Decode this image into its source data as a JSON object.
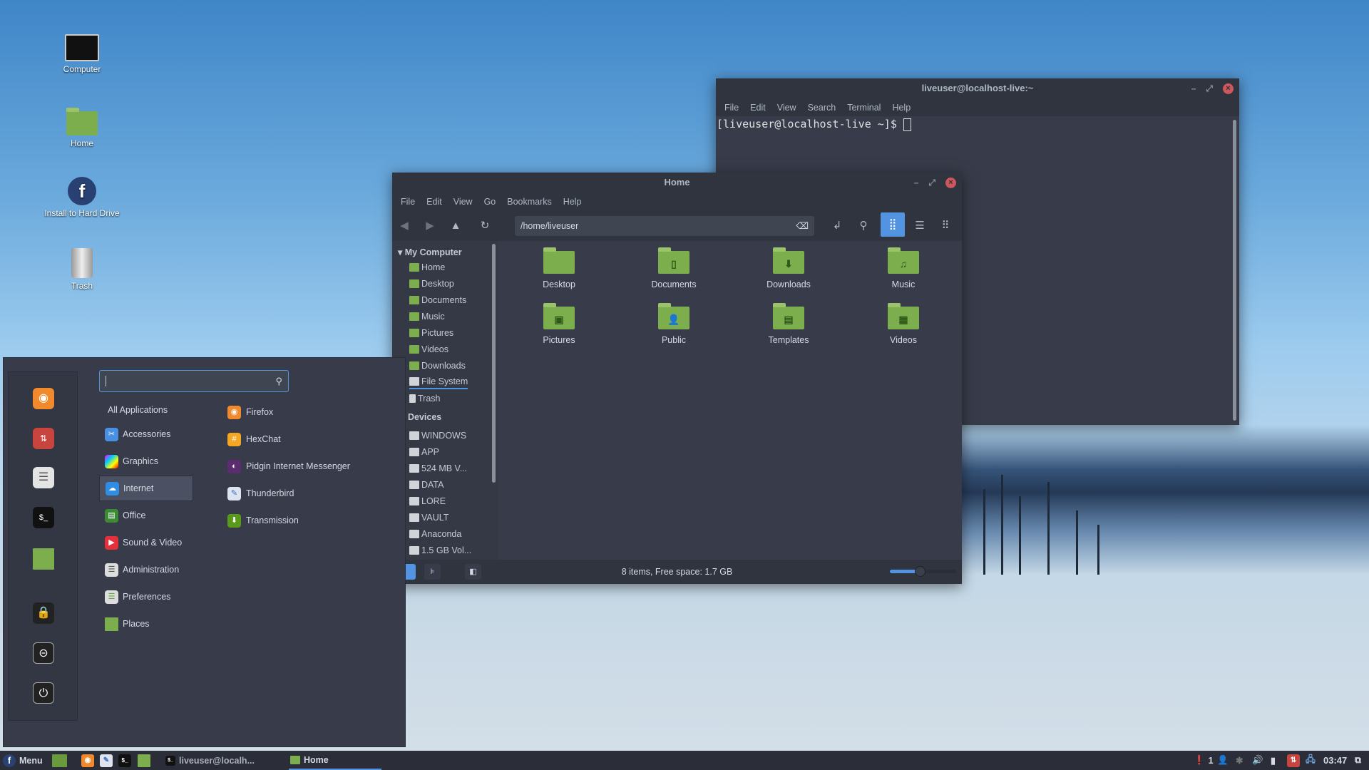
{
  "desktop": {
    "icons": [
      {
        "label": "Computer",
        "icon": "monitor-icon"
      },
      {
        "label": "Home",
        "icon": "home-folder-icon"
      },
      {
        "label": "Install to Hard Drive",
        "icon": "fedora-install-icon"
      },
      {
        "label": "Trash",
        "icon": "trash-icon"
      }
    ]
  },
  "terminal": {
    "title": "liveuser@localhost-live:~",
    "menu": [
      "File",
      "Edit",
      "View",
      "Search",
      "Terminal",
      "Help"
    ],
    "prompt": "[liveuser@localhost-live ~]$ "
  },
  "files": {
    "title": "Home",
    "menu": [
      "File",
      "Edit",
      "View",
      "Go",
      "Bookmarks",
      "Help"
    ],
    "location": "/home/liveuser",
    "sidebar": {
      "my_computer": "My Computer",
      "places": [
        "Home",
        "Desktop",
        "Documents",
        "Music",
        "Pictures",
        "Videos",
        "Downloads",
        "File System",
        "Trash"
      ],
      "devices_label": "Devices",
      "devices": [
        "WINDOWS",
        "APP",
        "524 MB V...",
        "DATA",
        "LORE",
        "VAULT",
        "Anaconda",
        "1.5 GB Vol..."
      ]
    },
    "items": [
      "Desktop",
      "Documents",
      "Downloads",
      "Music",
      "Pictures",
      "Public",
      "Templates",
      "Videos"
    ],
    "status": "8 items, Free space: 1.7 GB",
    "zoom_level": 0.45,
    "active_view": "icon-view"
  },
  "menu": {
    "search_value": "",
    "categories": [
      "All Applications",
      "Accessories",
      "Graphics",
      "Internet",
      "Office",
      "Sound & Video",
      "Administration",
      "Preferences",
      "Places"
    ],
    "selected_category": "Internet",
    "apps": [
      "Firefox",
      "HexChat",
      "Pidgin Internet Messenger",
      "Thunderbird",
      "Transmission"
    ]
  },
  "taskbar": {
    "menu_label": "Menu",
    "windows": [
      "liveuser@localh...",
      "Home"
    ],
    "notifications": "1",
    "clock": "03:47"
  },
  "colors": {
    "accent": "#5294e2",
    "folder": "#7cae4e",
    "panel": "#2b2e39",
    "window": "#383c4a",
    "close": "#cc575d"
  }
}
